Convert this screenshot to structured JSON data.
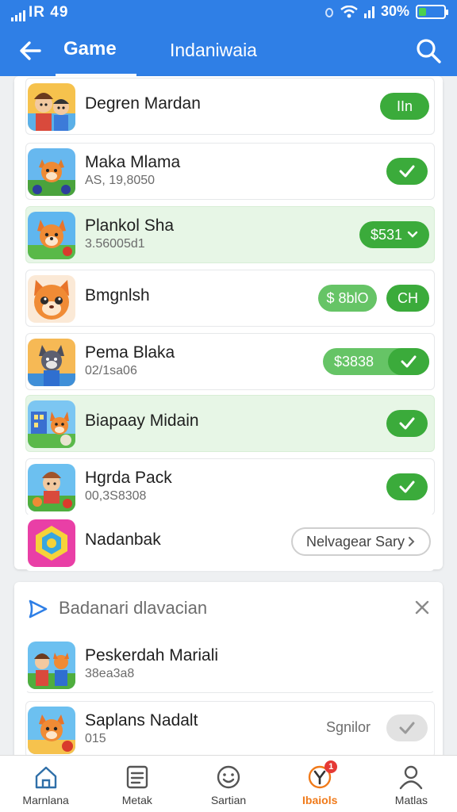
{
  "status_bar": {
    "left_text": "IR 49",
    "battery_percent": "30%",
    "battery_level": 0.3
  },
  "nav": {
    "title": "Game",
    "subtitle": "Indaniwaia"
  },
  "colors": {
    "primary": "#2f7fe6",
    "green": "#3bab3b",
    "highlight": "#e7f6e6",
    "active_tab": "#f07a1a"
  },
  "games": [
    {
      "name": "Degren Mardan",
      "sub": "",
      "action": "IIn",
      "action_type": "pill",
      "highlighted": false,
      "icon": "characters-icon"
    },
    {
      "name": "Maka Mlama",
      "sub": "AS, 19,8050",
      "action": "",
      "action_type": "check",
      "highlighted": false,
      "icon": "fox-adventure-icon"
    },
    {
      "name": "Plankol Sha",
      "sub": "3.56005d1",
      "action": "$531",
      "action_type": "pill-check",
      "highlighted": true,
      "icon": "fox-icon"
    },
    {
      "name": "Bmgnlsh",
      "sub": "",
      "action": "$ 8blO",
      "action2": "CH",
      "action_type": "double",
      "highlighted": false,
      "icon": "cat-face-icon"
    },
    {
      "name": "Pema Blaka",
      "sub": "02/1sa06",
      "action": "$3838",
      "action_type": "pill-check",
      "highlighted": false,
      "icon": "wolf-icon"
    },
    {
      "name": "Biapaay Midain",
      "sub": "",
      "action": "",
      "action_type": "check",
      "highlighted": true,
      "icon": "town-fox-icon"
    },
    {
      "name": "Hgrda Pack",
      "sub": "00,3S8308",
      "action": "",
      "action_type": "check",
      "highlighted": false,
      "icon": "adventurer-icon"
    },
    {
      "name": "Nadanbak",
      "sub": "",
      "action": "Nelvagear Sary",
      "action_type": "outline",
      "highlighted": false,
      "icon": "puzzle-icon"
    }
  ],
  "recommendations": {
    "title": "Badanari dlavacian",
    "items": [
      {
        "name": "Peskerdah Mariali",
        "sub": "38ea3a8",
        "icon": "group-icon"
      },
      {
        "name": "Saplans Nadalt",
        "sub": "015",
        "right_text": "Sgnilor",
        "icon": "fox-cannon-icon"
      }
    ]
  },
  "tabs": [
    {
      "label": "Marnlana",
      "icon": "home-icon",
      "active": false
    },
    {
      "label": "Metak",
      "icon": "list-icon",
      "active": false
    },
    {
      "label": "Sartian",
      "icon": "smiley-icon",
      "active": false
    },
    {
      "label": "Ibaiols",
      "icon": "y-badge-icon",
      "active": true,
      "badge": "1"
    },
    {
      "label": "Matlas",
      "icon": "person-icon",
      "active": false
    }
  ]
}
